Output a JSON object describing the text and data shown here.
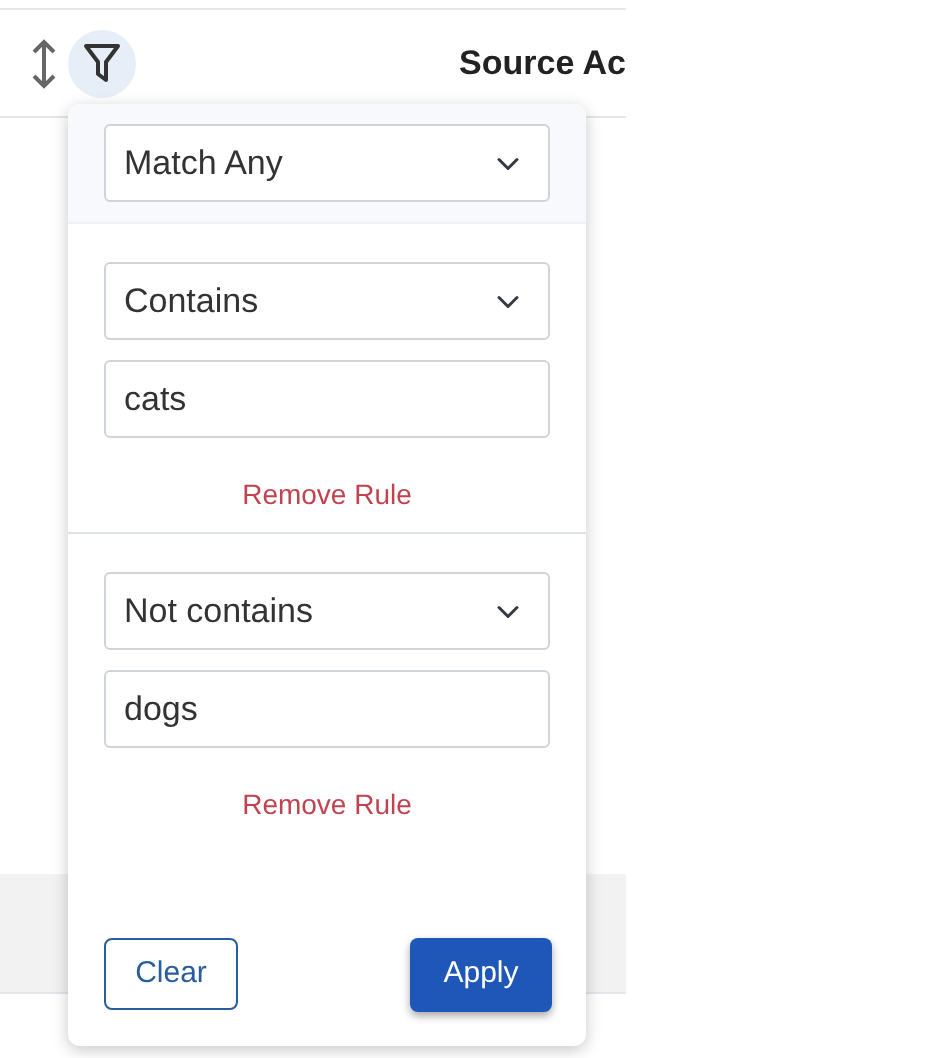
{
  "table": {
    "header_label": "Source Ac",
    "filter_active": true
  },
  "filter_popup": {
    "match_mode": "Match Any",
    "rules": [
      {
        "condition": "Contains",
        "value": "cats",
        "remove_label": "Remove Rule"
      },
      {
        "condition": "Not contains",
        "value": "dogs",
        "remove_label": "Remove Rule"
      }
    ],
    "buttons": {
      "clear": "Clear",
      "apply": "Apply"
    }
  }
}
